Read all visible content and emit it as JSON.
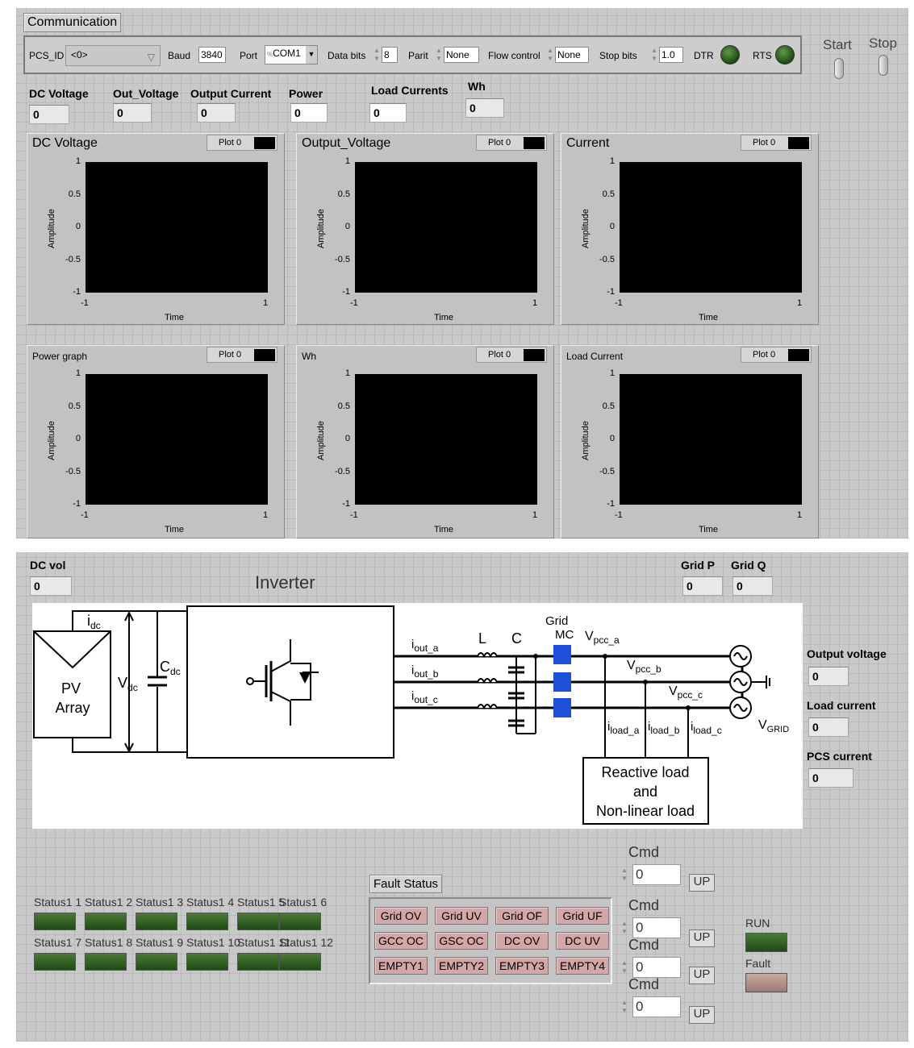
{
  "communication": {
    "tab": "Communication",
    "pcs_id_label": "PCS_ID",
    "pcs_id_value": "<0>",
    "baud_label": "Baud",
    "baud_value": "3840",
    "port_label": "Port",
    "port_value": "COM1",
    "data_bits_label": "Data bits",
    "data_bits_value": "8",
    "parity_label": "Parit",
    "parity_value": "None",
    "flow_label": "Flow control",
    "flow_value": "None",
    "stop_bits_label": "Stop bits",
    "stop_bits_value": "1.0",
    "dtr_label": "DTR",
    "rts_label": "RTS"
  },
  "switches": {
    "start": "Start",
    "stop": "Stop"
  },
  "readouts": [
    {
      "label": "DC Voltage",
      "value": "0"
    },
    {
      "label": "Out_Voltage",
      "value": "0"
    },
    {
      "label": "Output Current",
      "value": "0"
    },
    {
      "label": "Power",
      "value": "0"
    },
    {
      "label": "Load Currents",
      "value": "0"
    },
    {
      "label": "Wh",
      "value": "0"
    }
  ],
  "graphs": [
    {
      "title": "DC Voltage",
      "legend": "Plot 0",
      "xlabel": "Time",
      "ylabel": "Amplitude",
      "yticks": [
        "1",
        "0.5",
        "0",
        "-0.5",
        "-1"
      ],
      "xticks": [
        "-1",
        "1"
      ],
      "xlim": [
        -1,
        1
      ],
      "ylim": [
        -1,
        1
      ]
    },
    {
      "title": "Output_Voltage",
      "legend": "Plot 0",
      "xlabel": "Time",
      "ylabel": "Amplitude",
      "yticks": [
        "1",
        "0.5",
        "0",
        "-0.5",
        "-1"
      ],
      "xticks": [
        "-1",
        "1"
      ],
      "xlim": [
        -1,
        1
      ],
      "ylim": [
        -1,
        1
      ]
    },
    {
      "title": "Current",
      "legend": "Plot 0",
      "xlabel": "Time",
      "ylabel": "Amplitude",
      "yticks": [
        "1",
        "0.5",
        "0",
        "-0.5",
        "-1"
      ],
      "xticks": [
        "-1",
        "1"
      ],
      "xlim": [
        -1,
        1
      ],
      "ylim": [
        -1,
        1
      ]
    },
    {
      "title": "Power graph",
      "legend": "Plot 0",
      "xlabel": "Time",
      "ylabel": "Amplitude",
      "yticks": [
        "1",
        "0.5",
        "0",
        "-0.5",
        "-1"
      ],
      "xticks": [
        "-1",
        "1"
      ],
      "xlim": [
        -1,
        1
      ],
      "ylim": [
        -1,
        1
      ]
    },
    {
      "title": "Wh",
      "legend": "Plot 0",
      "xlabel": "Time",
      "ylabel": "Amplitude",
      "yticks": [
        "1",
        "0.5",
        "0",
        "-0.5",
        "-1"
      ],
      "xticks": [
        "-1",
        "1"
      ],
      "xlim": [
        -1,
        1
      ],
      "ylim": [
        -1,
        1
      ]
    },
    {
      "title": "Load Current",
      "legend": "Plot 0",
      "xlabel": "Time",
      "ylabel": "Amplitude",
      "yticks": [
        "1",
        "0.5",
        "0",
        "-0.5",
        "-1"
      ],
      "xticks": [
        "-1",
        "1"
      ],
      "xlim": [
        -1,
        1
      ],
      "ylim": [
        -1,
        1
      ]
    }
  ],
  "bottom": {
    "dc_vol_label": "DC vol",
    "dc_vol_value": "0",
    "grid_p_label": "Grid P",
    "grid_p_value": "0",
    "grid_q_label": "Grid Q",
    "grid_q_value": "0",
    "inverter_label": "Inverter",
    "right_readouts": [
      {
        "label": "Output voltage",
        "value": "0"
      },
      {
        "label": "Load current",
        "value": "0"
      },
      {
        "label": "PCS current",
        "value": "0"
      }
    ]
  },
  "diagram": {
    "pv": [
      "PV",
      "Array"
    ],
    "idc": "i",
    "idc_sub": "dc",
    "vdc": "V",
    "vdc_sub": "dc",
    "cdc": "C",
    "cdc_sub": "dc",
    "L": "L",
    "C": "C",
    "grid_mc": [
      "Grid",
      "MC"
    ],
    "iout": [
      {
        "t": "i",
        "s": "out_a"
      },
      {
        "t": "i",
        "s": "out_b"
      },
      {
        "t": "i",
        "s": "out_c"
      }
    ],
    "vpcc": [
      {
        "t": "V",
        "s": "pcc_a"
      },
      {
        "t": "V",
        "s": "pcc_b"
      },
      {
        "t": "V",
        "s": "pcc_c"
      }
    ],
    "iload": [
      {
        "t": "i",
        "s": "load_a"
      },
      {
        "t": "i",
        "s": "load_b"
      },
      {
        "t": "i",
        "s": "load_c"
      }
    ],
    "vgrid": "V",
    "vgrid_sub": "GRID",
    "load": [
      "Reactive load",
      "and",
      "Non-linear load"
    ],
    "mc_color": "#1e4fd8"
  },
  "status": {
    "row1": [
      "Status1 1",
      "Status1 2",
      "Status1 3",
      "Status1 4",
      "Status1 5",
      "Status1 6"
    ],
    "row2": [
      "Status1 7",
      "Status1 8",
      "Status1 9",
      "Status1 10",
      "Status1 11",
      "Status1 12"
    ],
    "led_color": "#2a5a1c"
  },
  "fault": {
    "title": "Fault Status",
    "buttons": [
      "Grid OV",
      "Grid UV",
      "Grid OF",
      "Grid UF",
      "GCC OC",
      "GSC OC",
      "DC OV",
      "DC UV",
      "EMPTY1",
      "EMPTY2",
      "EMPTY3",
      "EMPTY4"
    ],
    "color": "#d3a6a8"
  },
  "cmds": [
    {
      "label": "Cmd",
      "value": "0",
      "button": "UP"
    },
    {
      "label": "Cmd",
      "value": "0",
      "button": "UP"
    },
    {
      "label": "Cmd",
      "value": "0",
      "button": "UP"
    },
    {
      "label": "Cmd",
      "value": "0",
      "button": "UP"
    }
  ],
  "indicators": {
    "run": "RUN",
    "fault": "Fault",
    "run_color": "#2a5a1c",
    "fault_color": "#b09088"
  }
}
